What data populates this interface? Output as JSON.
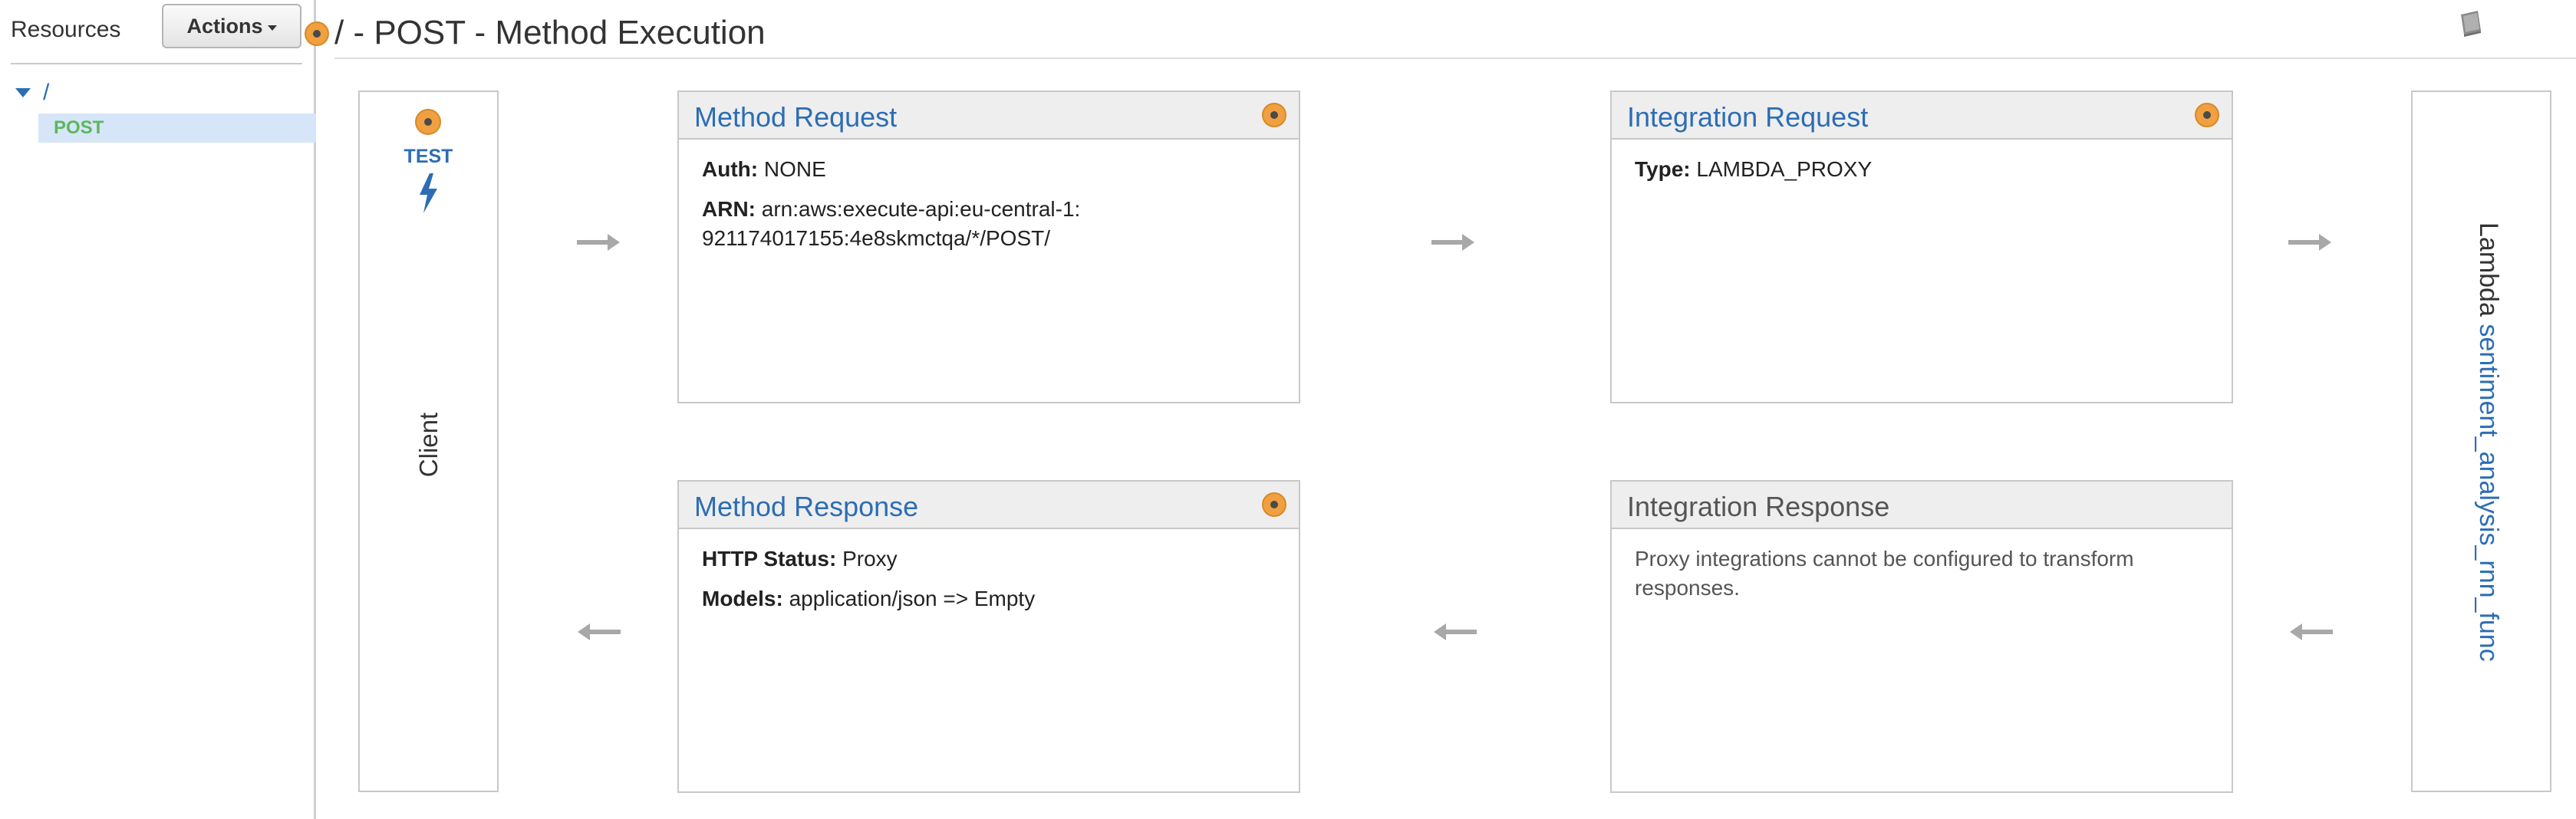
{
  "sidebar": {
    "resources_label": "Resources",
    "actions_label": "Actions",
    "tree": {
      "root": "/",
      "method": "POST"
    }
  },
  "header": {
    "title": "/ - POST - Method Execution"
  },
  "client": {
    "test_label": "TEST",
    "label": "Client"
  },
  "method_request": {
    "title": "Method Request",
    "auth_label": "Auth:",
    "auth_value": "NONE",
    "arn_label": "ARN:",
    "arn_value": "arn:aws:execute-api:eu-central-1:921174017155:4e8skmctqa/*/POST/"
  },
  "integration_request": {
    "title": "Integration Request",
    "type_label": "Type:",
    "type_value": "LAMBDA_PROXY"
  },
  "method_response": {
    "title": "Method Response",
    "status_label": "HTTP Status:",
    "status_value": "Proxy",
    "models_label": "Models:",
    "models_value": "application/json => Empty"
  },
  "integration_response": {
    "title": "Integration Response",
    "message": "Proxy integrations cannot be configured to transform responses."
  },
  "lambda": {
    "label": "Lambda",
    "function_name": "sentiment_analysis_rnn_func"
  },
  "colors": {
    "link": "#2c6db5",
    "method_green": "#5cb85c",
    "status_orange": "#f0a040",
    "selection": "#d6e6f8"
  },
  "icons": [
    "settings-badge-icon",
    "lightning-bolt-icon",
    "documentation-icon",
    "arrow-right-icon",
    "arrow-left-icon",
    "tree-expand-icon"
  ]
}
